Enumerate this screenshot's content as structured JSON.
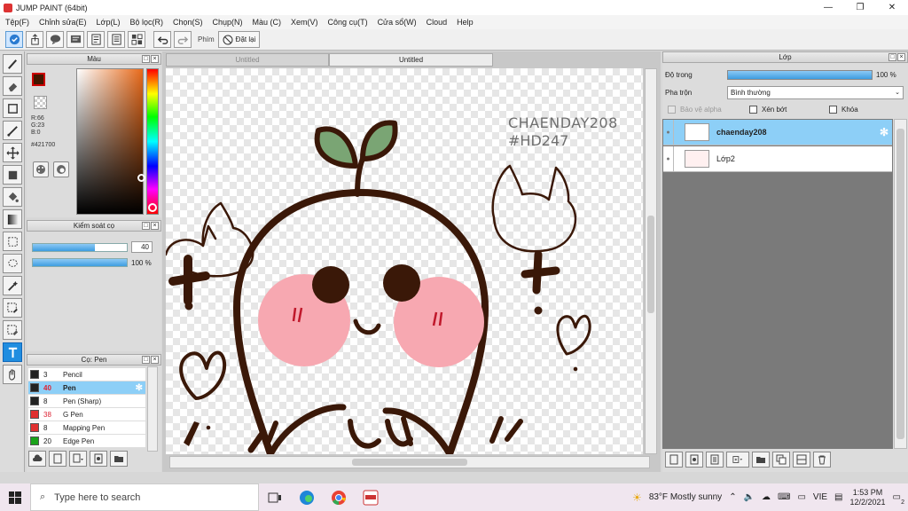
{
  "window": {
    "title": "JUMP PAINT (64bit)",
    "controls": [
      "—",
      "❐",
      "✕"
    ]
  },
  "menu": [
    "Tệp(F)",
    "Chỉnh sửa(E)",
    "Lớp(L)",
    "Bộ lọc(R)",
    "Chọn(S)",
    "Chụp(N)",
    "Màu (C)",
    "Xem(V)",
    "Công cụ(T)",
    "Cửa sổ(W)",
    "Cloud",
    "Help"
  ],
  "toolbar": {
    "keys_label": "Phím",
    "reset_label": "Đặt lại"
  },
  "color_panel": {
    "title": "Màu",
    "main_color": "#421700",
    "rgb": {
      "r": "R:66",
      "g": "G:23",
      "b": "B:0"
    },
    "hex": "#421700"
  },
  "brush_control": {
    "title": "Kiểm soát cọ",
    "size_value": "40",
    "size_fraction": 0.66,
    "opacity_value": "100 %",
    "opacity_fraction": 1.0
  },
  "brush_list": {
    "title": "Cọ: Pen",
    "items": [
      {
        "size": "3",
        "name": "Pencil",
        "color": "#222222"
      },
      {
        "size": "40",
        "name": "Pen",
        "color": "#222222"
      },
      {
        "size": "8",
        "name": "Pen (Sharp)",
        "color": "#222222"
      },
      {
        "size": "38",
        "name": "G Pen",
        "color": "#e03030"
      },
      {
        "size": "8",
        "name": "Mapping Pen",
        "color": "#e03030"
      },
      {
        "size": "20",
        "name": "Edge Pen",
        "color": "#1aa31a"
      }
    ]
  },
  "documents": {
    "tabs": [
      "Untitled",
      "Untitled"
    ],
    "canvas_text_line1": "CHAENDAY208",
    "canvas_text_line2": "#HD247"
  },
  "layer_panel": {
    "title": "Lớp",
    "opacity_label": "Độ trong",
    "opacity_value": "100 %",
    "blend_label": "Pha trộn",
    "blend_value": "Bình thường",
    "protect_alpha": "Bảo vệ alpha",
    "clipping": "Xén bớt",
    "lock": "Khóa",
    "layers": [
      {
        "name": "chaenday208",
        "selected": true
      },
      {
        "name": "Lớp2",
        "selected": false
      }
    ]
  },
  "taskbar": {
    "search_placeholder": "Type here to search",
    "weather": "83°F  Mostly sunny",
    "lang": "VIE",
    "time": "1:53 PM",
    "date": "12/2/2021",
    "notif_count": "2"
  }
}
